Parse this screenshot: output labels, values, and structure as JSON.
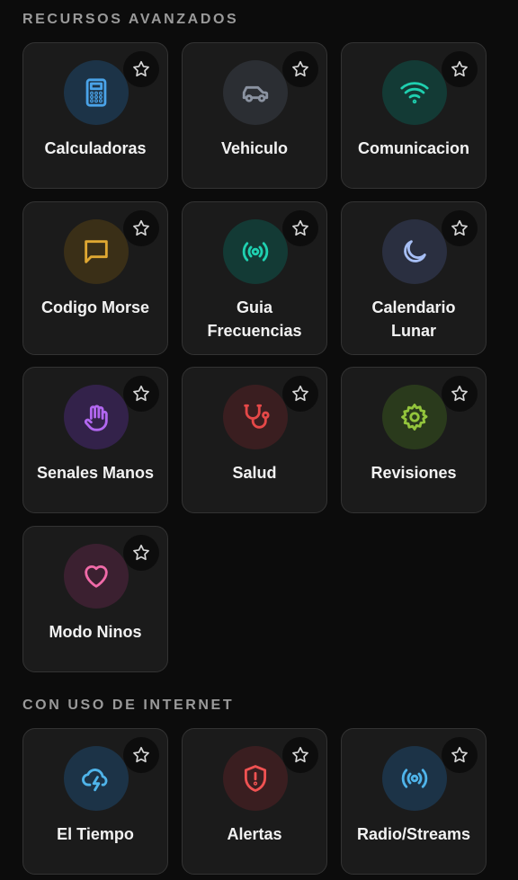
{
  "sections": {
    "advanced": {
      "title": "RECURSOS AVANZADOS",
      "items": [
        {
          "label": "Calculadoras",
          "icon": "calculator-icon",
          "color": "#4aa3e8",
          "bg": "#1c3347"
        },
        {
          "label": "Vehiculo",
          "icon": "car-icon",
          "color": "#8b93a1",
          "bg": "#2b2e33"
        },
        {
          "label": "Comunicacion",
          "icon": "wifi-icon",
          "color": "#1fd0b0",
          "bg": "#133a35"
        },
        {
          "label": "Codigo Morse",
          "icon": "message-square-icon",
          "color": "#e0a832",
          "bg": "#3a2f17"
        },
        {
          "label": "Guia Frecuencias",
          "icon": "radio-broadcast-icon",
          "color": "#1fd0b0",
          "bg": "#133a35"
        },
        {
          "label": "Calendario Lunar",
          "icon": "moon-icon",
          "color": "#a7bff5",
          "bg": "#2a2f40"
        },
        {
          "label": "Senales Manos",
          "icon": "hand-icon",
          "color": "#b267f0",
          "bg": "#33224a"
        },
        {
          "label": "Salud",
          "icon": "stethoscope-icon",
          "color": "#e54848",
          "bg": "#3a1e20"
        },
        {
          "label": "Revisiones",
          "icon": "gear-icon",
          "color": "#93c53c",
          "bg": "#2a3a1c"
        },
        {
          "label": "Modo Ninos",
          "icon": "heart-icon",
          "color": "#f06aa8",
          "bg": "#3b2030"
        }
      ]
    },
    "internet": {
      "title": "CON USO DE INTERNET",
      "items": [
        {
          "label": "El Tiempo",
          "icon": "cloud-lightning-icon",
          "color": "#4fb4ea",
          "bg": "#1c3347"
        },
        {
          "label": "Alertas",
          "icon": "shield-alert-icon",
          "color": "#f05252",
          "bg": "#3a1e20"
        },
        {
          "label": "Radio/Streams",
          "icon": "radio-broadcast-icon",
          "color": "#4fb4ea",
          "bg": "#1c3347"
        }
      ]
    }
  }
}
